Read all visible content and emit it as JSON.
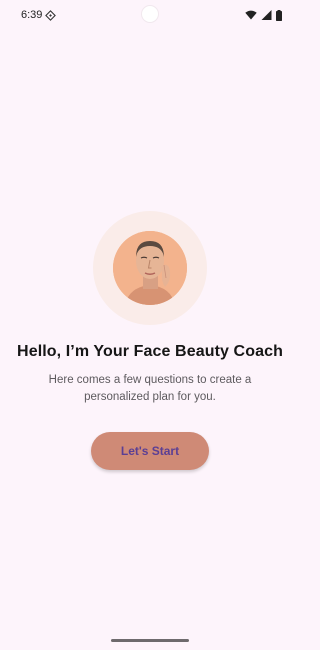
{
  "status_bar": {
    "time": "6:39",
    "icons": [
      "sim-card-icon",
      "wifi-icon",
      "cellular-signal-icon",
      "battery-icon"
    ]
  },
  "onboarding": {
    "avatar_icon": "face-portrait-icon",
    "title": "Hello, I’m Your Face Beauty Coach",
    "subtitle": "Here comes a few questions to create a personalized plan for you.",
    "start_button_label": "Let's Start"
  },
  "colors": {
    "background": "#fdf4fb",
    "accent_button": "#cf8a76",
    "button_text": "#5b3f94",
    "avatar_halo": "#faece9",
    "avatar_background": "#f3b38d"
  }
}
